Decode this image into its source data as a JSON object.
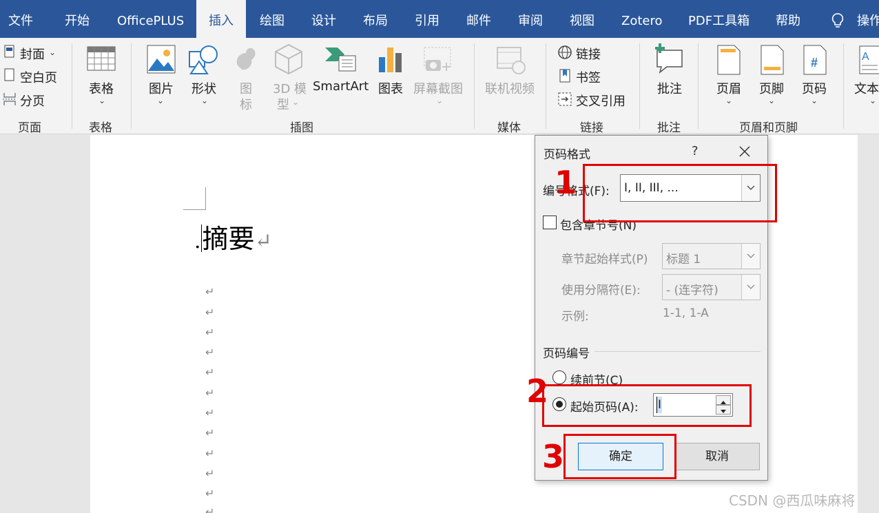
{
  "menu": {
    "tabs": [
      "文件",
      "开始",
      "OfficePLUS",
      "插入",
      "绘图",
      "设计",
      "布局",
      "引用",
      "邮件",
      "审阅",
      "视图",
      "Zotero",
      "PDF工具箱",
      "帮助",
      "操作"
    ],
    "active_tab": "插入"
  },
  "ribbon": {
    "pages": {
      "cover": "封面",
      "blank_page": "空白页",
      "page_break": "分页",
      "group": "页面"
    },
    "tables": {
      "table": "表格",
      "group": "表格"
    },
    "illustrations": {
      "picture": "图片",
      "shapes": "形状",
      "icons_1": "图",
      "icons_2": "标",
      "models_1": "3D 模",
      "models_2": "型",
      "smartart": "SmartArt",
      "chart": "图表",
      "screenshot": "屏幕截图",
      "group": "插图"
    },
    "media": {
      "online_video": "联机视频",
      "group": "媒体"
    },
    "links": {
      "link": "链接",
      "bookmark": "书签",
      "cross_ref": "交叉引用",
      "group": "链接"
    },
    "comments": {
      "comment": "批注",
      "group": "批注"
    },
    "header_footer": {
      "header": "页眉",
      "footer": "页脚",
      "page_number": "页码",
      "group": "页眉和页脚"
    },
    "text": {
      "textbox": "文本"
    }
  },
  "document": {
    "heading": "摘要",
    "bullet": ".",
    "return_mark": "↵"
  },
  "dialog": {
    "title": "页码格式",
    "help": "?",
    "number_format_label": "编号格式(F):",
    "number_format_value": "I, II, III, ...",
    "include_chapter_label": "包含章节号(N)",
    "chapter_style_label": "章节起始样式(P)",
    "chapter_style_value": "标题 1",
    "separator_label": "使用分隔符(E):",
    "separator_value": "-   (连字符)",
    "example_label": "示例:",
    "example_value": "1-1, 1-A",
    "numbering_section": "页码编号",
    "continue_label": "续前节(C)",
    "start_at_label": "起始页码(A):",
    "start_at_value": "I",
    "ok": "确定",
    "cancel": "取消"
  },
  "annotations": [
    "1",
    "2",
    "3"
  ],
  "watermark": "CSDN @西瓜味麻将",
  "colors": {
    "title_bar": "#2b579a",
    "annotation": "#e00000",
    "ok_border": "#0078d7"
  }
}
